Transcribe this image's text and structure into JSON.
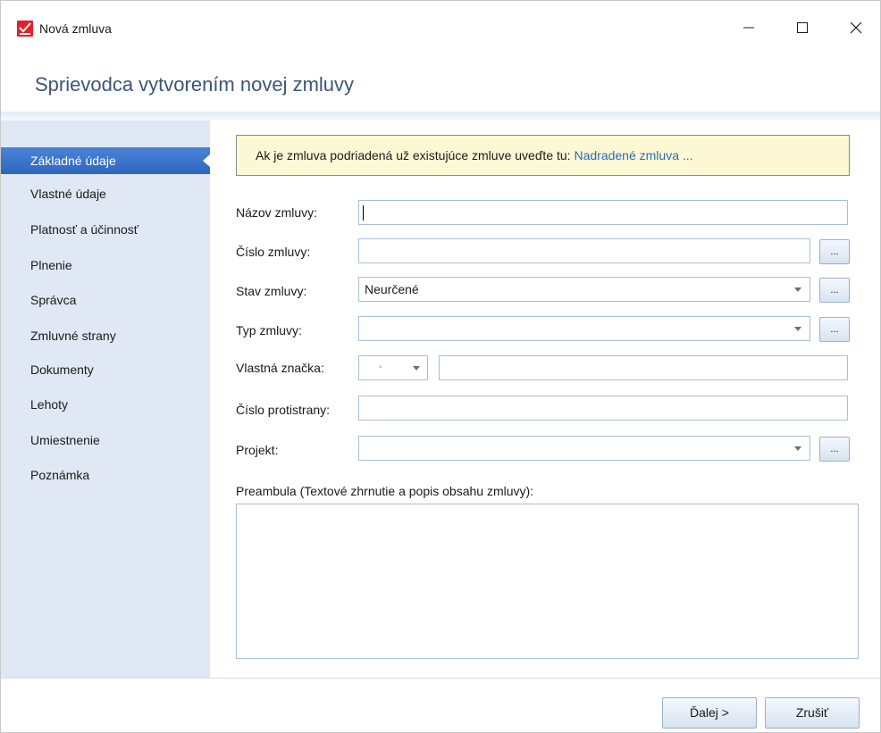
{
  "window": {
    "title": "Nová zmluva",
    "icon": "checkmark-envelope-icon",
    "controls": {
      "minimize": "—",
      "maximize": "☐",
      "close": "✕"
    }
  },
  "header": {
    "title": "Sprievodca vytvorením novej zmluvy"
  },
  "sidebar": {
    "items": [
      {
        "label": "Základné údaje",
        "active": true
      },
      {
        "label": "Vlastné údaje"
      },
      {
        "label": "Platnosť a účinnosť"
      },
      {
        "label": "Plnenie"
      },
      {
        "label": "Správca"
      },
      {
        "label": "Zmluvné strany"
      },
      {
        "label": "Dokumenty"
      },
      {
        "label": "Lehoty"
      },
      {
        "label": "Umiestnenie"
      },
      {
        "label": "Poznámka"
      }
    ]
  },
  "info": {
    "text": "Ak je zmluva podriadená už existujúce zmluve uveďte tu:",
    "link": "Nadradené zmluva ..."
  },
  "form": {
    "nazov_label": "Názov zmluvy:",
    "nazov_value": "",
    "cislo_label": "Číslo zmluvy:",
    "cislo_value": "",
    "stav_label": "Stav zmluvy:",
    "stav_value": "Neurčené",
    "typ_label": "Typ zmluvy:",
    "typ_value": "",
    "znacka_label": "Vlastná značka:",
    "znacka_value": "",
    "protistrana_label": "Číslo protistrany:",
    "protistrana_value": "",
    "projekt_label": "Projekt:",
    "projekt_value": "",
    "ellipsis_label": "...",
    "preambula_label": "Preambula (Textové zhrnutie a popis obsahu zmluvy):",
    "preambula_value": ""
  },
  "footer": {
    "next_label": "Ďalej >",
    "cancel_label": "Zrušiť"
  },
  "colors": {
    "accent": "#2e66be",
    "sidebar_bg": "#dfe8f4",
    "info_bg": "#fdf8d4",
    "link": "#2a6cb3",
    "header_text": "#3b5678"
  }
}
